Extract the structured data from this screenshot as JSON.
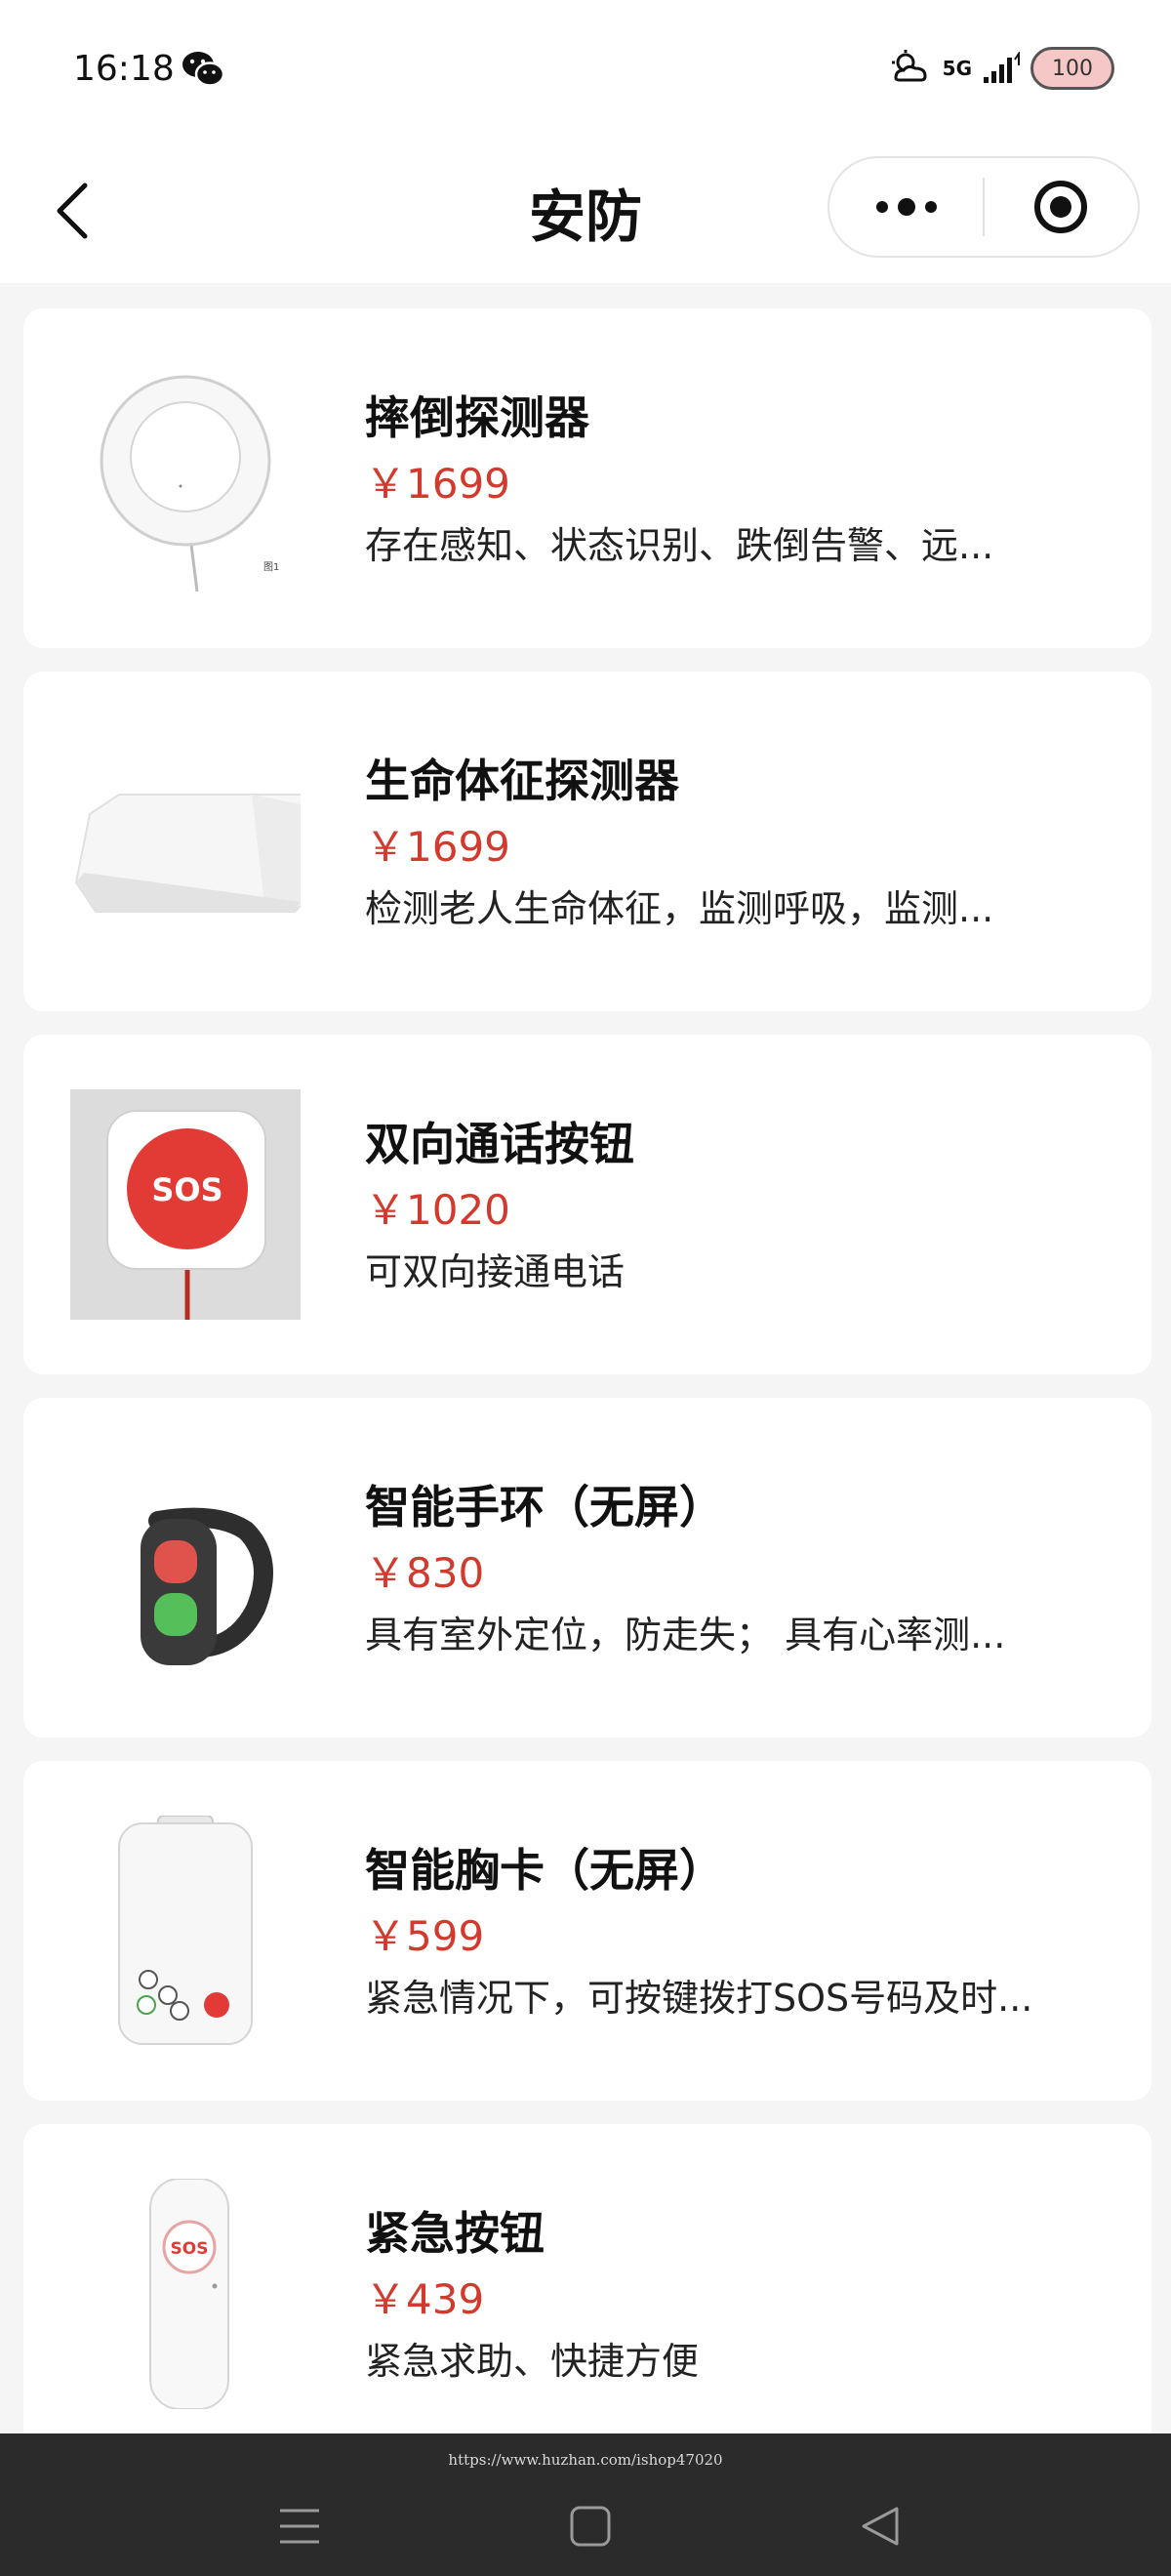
{
  "status_bar": {
    "time": "16:18",
    "network": "5G",
    "battery": "100"
  },
  "nav": {
    "title": "安防"
  },
  "products": [
    {
      "name": "摔倒探测器",
      "price": "￥1699",
      "description": "存在感知、状态识别、跌倒告警、远...",
      "image_caption": "图1"
    },
    {
      "name": "生命体征探测器",
      "price": "￥1699",
      "description": "检测老人生命体征，监测呼吸，监测..."
    },
    {
      "name": "双向通话按钮",
      "price": "￥1020",
      "description": "可双向接通电话",
      "image_label": "SOS"
    },
    {
      "name": "智能手环（无屏）",
      "price": "￥830",
      "description": "具有室外定位，防走失； 具有心率测..."
    },
    {
      "name": "智能胸卡（无屏）",
      "price": "￥599",
      "description": "紧急情况下，可按键拨打SOS号码及时..."
    },
    {
      "name": "紧急按钮",
      "price": "￥439",
      "description": "紧急求助、快捷方便",
      "image_label": "SOS"
    }
  ],
  "footer": {
    "watermark": "https://www.huzhan.com/ishop47020"
  },
  "colors": {
    "price": "#d23a2e",
    "sos_red": "#e23b36",
    "system_nav_bg": "#2b2b2b"
  }
}
